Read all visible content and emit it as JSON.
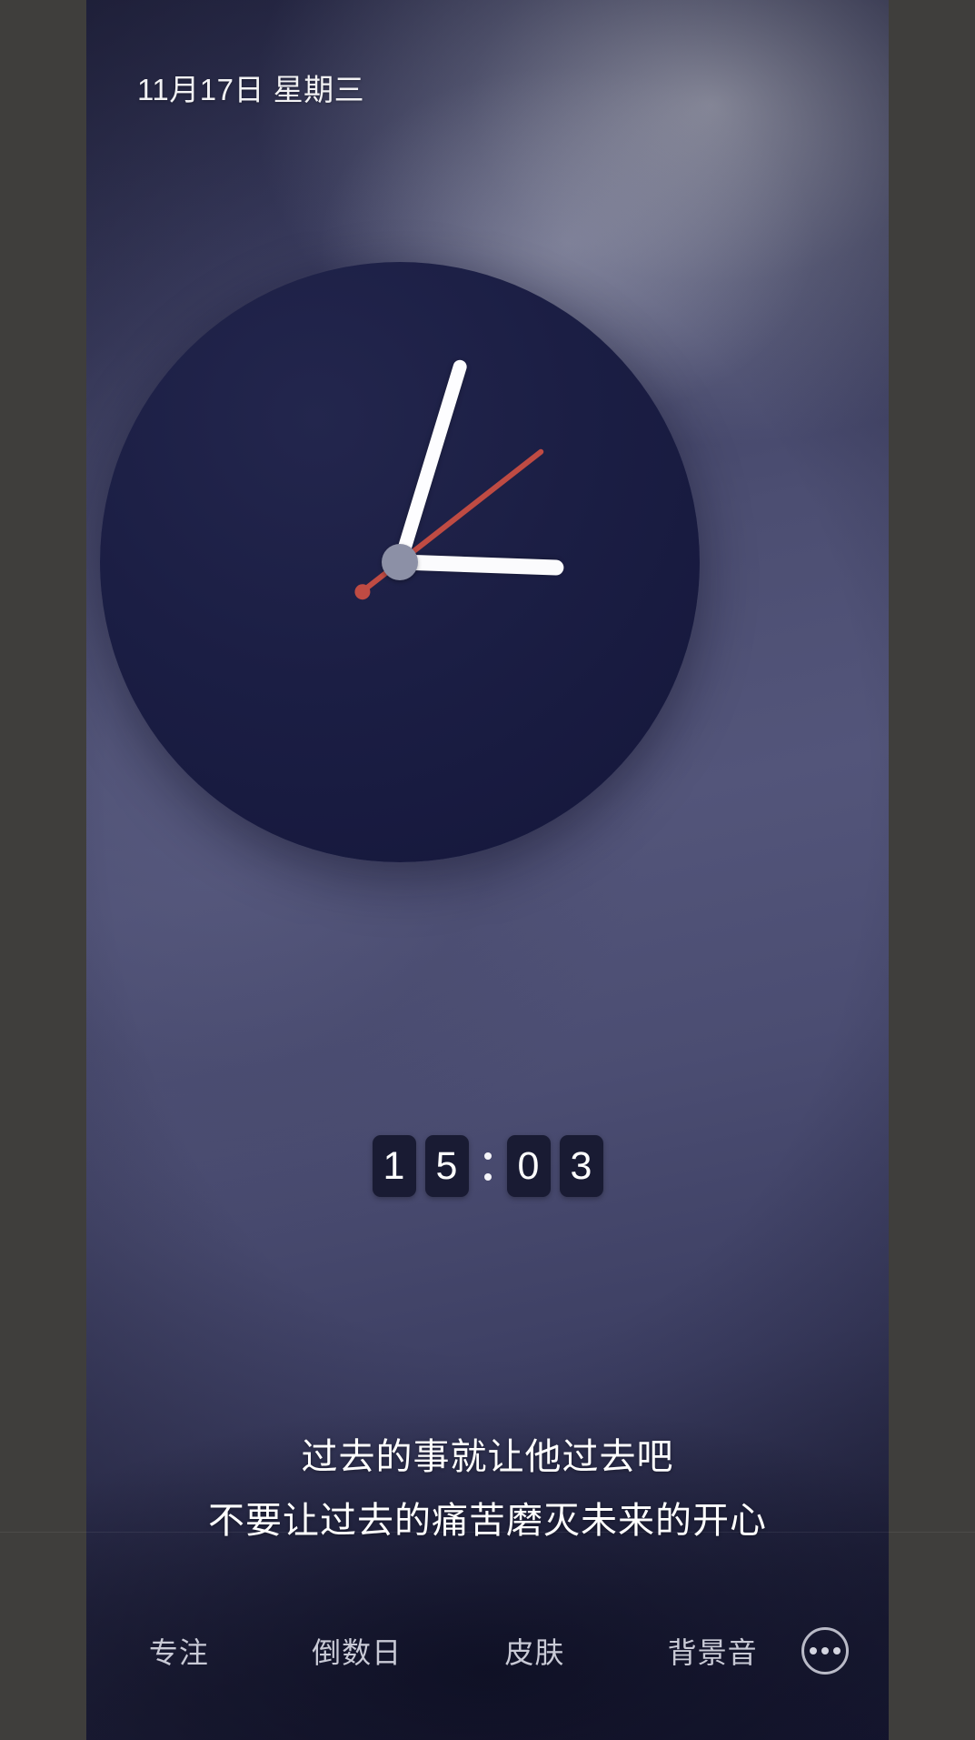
{
  "status": {
    "date_label": "11月17日 星期三"
  },
  "analog_clock": {
    "hour_hand_deg": 92,
    "minute_hand_deg": 17,
    "second_hand_deg": 52,
    "face_color": "#1b1e44",
    "hand_color": "#fdfdff",
    "second_hand_color": "#bf4b43",
    "hub_color": "#8c90a6"
  },
  "digital_clock": {
    "time": "15:03",
    "digits": [
      "1",
      "5",
      "0",
      "3"
    ],
    "tile_color": "#191b33",
    "digit_color": "#ffffff"
  },
  "quote": {
    "line1": "过去的事就让他过去吧",
    "line2": "不要让过去的痛苦磨灭未来的开心"
  },
  "bottom_nav": {
    "items": [
      {
        "label": "专注",
        "name": "nav-focus"
      },
      {
        "label": "倒数日",
        "name": "nav-countdown"
      },
      {
        "label": "皮肤",
        "name": "nav-skin"
      },
      {
        "label": "背景音",
        "name": "nav-ambient-sound"
      }
    ],
    "more_icon": "ellipsis-icon",
    "text_color": "#c9cad6"
  },
  "theme": {
    "letterbox_color": "#3f3e3c",
    "wallpaper_dark": "#1e2040",
    "wallpaper_light": "#53557a",
    "accent_red": "#bf4b43"
  }
}
